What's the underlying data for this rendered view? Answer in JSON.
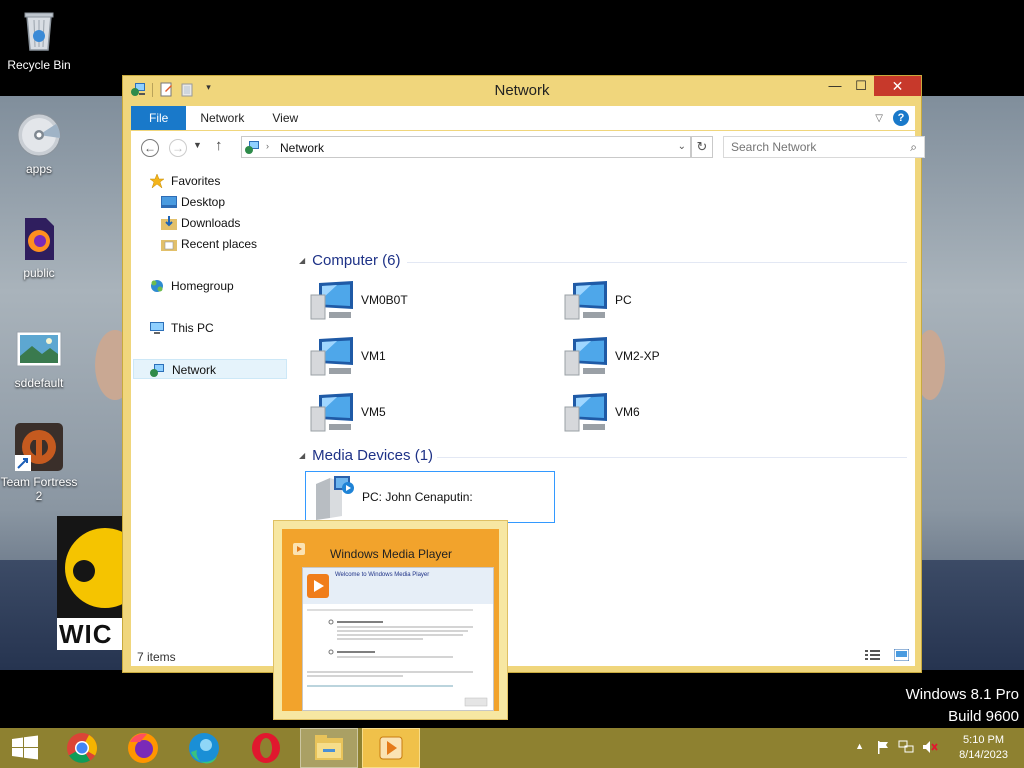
{
  "desktop": {
    "icons": [
      {
        "label": "Recycle Bin"
      },
      {
        "label": "apps"
      },
      {
        "label": "public"
      },
      {
        "label": "sddefault"
      },
      {
        "label": "Team Fortress 2"
      }
    ],
    "wallpaper_logo_text": "WIC"
  },
  "explorer": {
    "title": "Network",
    "ribbon_tabs": [
      "File",
      "Network",
      "View"
    ],
    "address": "Network",
    "search_placeholder": "Search Network",
    "nav_pane": {
      "favorites": "Favorites",
      "favorites_items": [
        "Desktop",
        "Downloads",
        "Recent places"
      ],
      "homegroup": "Homegroup",
      "this_pc": "This PC",
      "network": "Network"
    },
    "groups": {
      "computer": {
        "header": "Computer (6)",
        "items": [
          "VM0B0T",
          "PC",
          "VM1",
          "VM2-XP",
          "VM5",
          "VM6"
        ]
      },
      "media": {
        "header": "Media Devices (1)",
        "items": [
          "PC: John Cenaputin:"
        ]
      }
    },
    "status": "7 items"
  },
  "thumbnail": {
    "title": "Windows Media Player",
    "inner_heading": "Welcome to Windows Media Player"
  },
  "watermark": {
    "line1": "Windows 8.1 Pro",
    "line2": "Build 9600"
  },
  "taskbar": {
    "apps": [
      "start-button",
      "chrome",
      "firefox",
      "edge",
      "opera",
      "file-explorer",
      "windows-media-player"
    ],
    "time": "5:10 PM",
    "date": "8/14/2023"
  },
  "colors": {
    "window_frame": "#f0d67c",
    "taskbar": "#8e8130",
    "accent": "#1979ca",
    "close_button": "#c7392b"
  }
}
